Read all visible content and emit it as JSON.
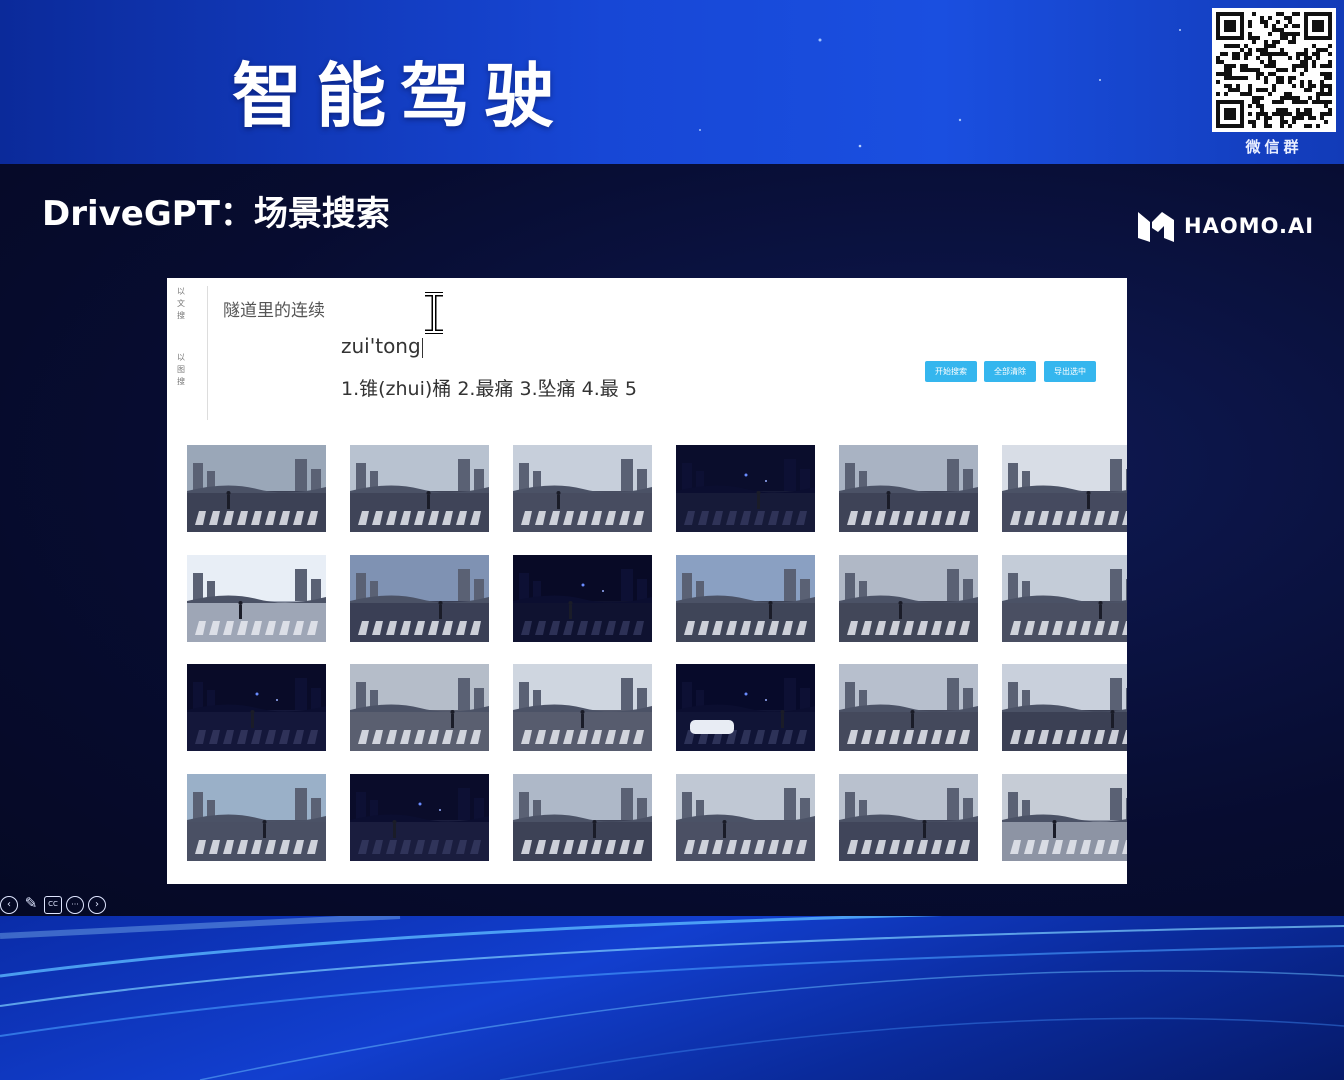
{
  "slide": {
    "title": "智能驾驶",
    "subtitle": "DriveGPT：场景搜索",
    "qr_caption": "微信群",
    "brand_name": "HAOMO.AI"
  },
  "search_ui": {
    "side_modes": [
      "以文搜",
      "以图搜"
    ],
    "query_text": "隧道里的连续",
    "ime_composition": "zui'tong",
    "ime_candidates": "1.锥(zhui)桶  2.最痛  3.坠痛  4.最  5",
    "buttons": [
      "开始搜索",
      "全部清除",
      "导出选中"
    ]
  },
  "results": {
    "thumbnails": [
      {
        "scene": "city-crosswalk-day",
        "sky": "#9aa7b8",
        "ground": "#3c4155"
      },
      {
        "scene": "city-crosswalk-day",
        "sky": "#b8c2d0",
        "ground": "#3f4458"
      },
      {
        "scene": "city-crosswalk-day",
        "sky": "#c7cfdb",
        "ground": "#474c60"
      },
      {
        "scene": "night-crosswalk",
        "sky": "#0a0d2c",
        "ground": "#161a38"
      },
      {
        "scene": "city-crosswalk-day",
        "sky": "#a9b3c3",
        "ground": "#3e4357"
      },
      {
        "scene": "city-crosswalk-sun",
        "sky": "#d8dde6",
        "ground": "#454a5f"
      },
      {
        "scene": "city-crosswalk-bright",
        "sky": "#e8eef6",
        "ground": "#9ea6b6"
      },
      {
        "scene": "city-crosswalk-day",
        "sky": "#7f92b3",
        "ground": "#3a3f55"
      },
      {
        "scene": "night-street",
        "sky": "#080a26",
        "ground": "#0f1230"
      },
      {
        "scene": "city-crosswalk-day",
        "sky": "#8aa0c2",
        "ground": "#3f4558"
      },
      {
        "scene": "city-crosswalk-day",
        "sky": "#b0b8c6",
        "ground": "#424759"
      },
      {
        "scene": "city-crosswalk-day",
        "sky": "#c4ccd8",
        "ground": "#4a4f62"
      },
      {
        "scene": "night-crosswalk",
        "sky": "#090b28",
        "ground": "#14173a"
      },
      {
        "scene": "street-shops",
        "sky": "#b5bdc9",
        "ground": "#5a5f70"
      },
      {
        "scene": "city-intersection",
        "sky": "#cfd6e0",
        "ground": "#575c6e"
      },
      {
        "scene": "night-car",
        "sky": "#070a2a",
        "ground": "#101436"
      },
      {
        "scene": "city-intersection",
        "sky": "#b7bfcd",
        "ground": "#44495c"
      },
      {
        "scene": "city-crosswalk-day",
        "sky": "#c9d0dc",
        "ground": "#3b4054"
      },
      {
        "scene": "tree-lined-road",
        "sky": "#9ab0c8",
        "ground": "#4a5064"
      },
      {
        "scene": "night-street",
        "sky": "#0a0c2a",
        "ground": "#1a1d3e"
      },
      {
        "scene": "city-crosswalk-day",
        "sky": "#aeb8c8",
        "ground": "#3d4256"
      },
      {
        "scene": "city-crosswalk-day",
        "sky": "#c0c8d4",
        "ground": "#4b5064"
      },
      {
        "scene": "city-crosswalk-day",
        "sky": "#b9c1ce",
        "ground": "#40455a"
      },
      {
        "scene": "bright-road",
        "sky": "#c6ccd6",
        "ground": "#8d94a4"
      }
    ]
  }
}
